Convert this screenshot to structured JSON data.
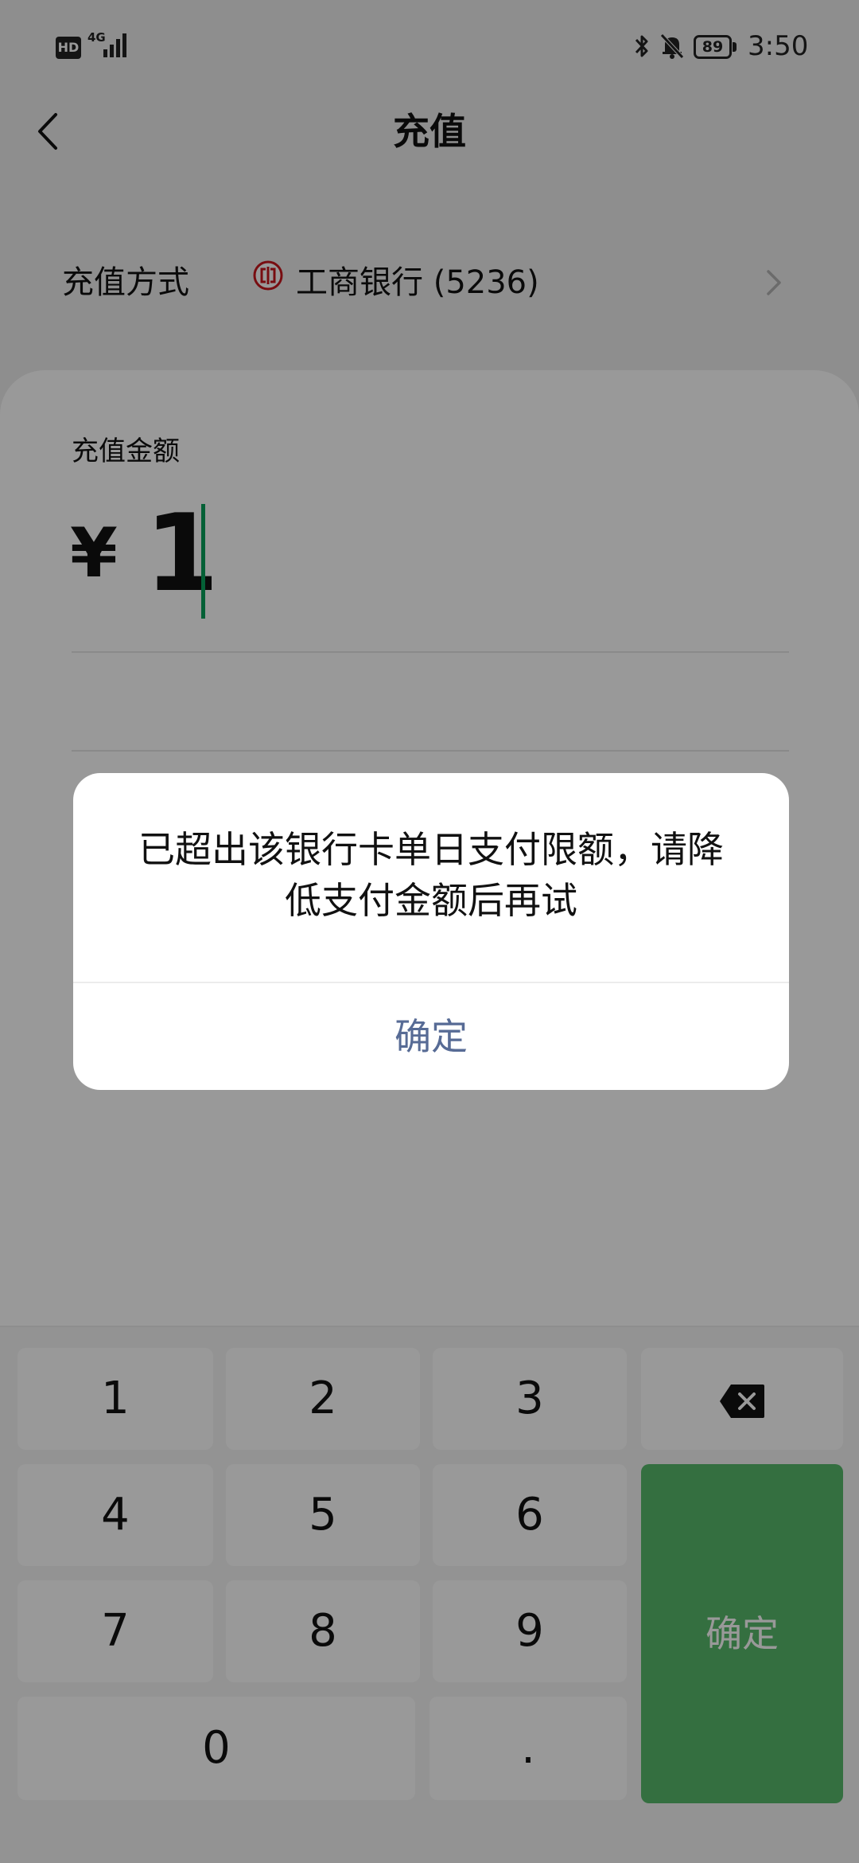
{
  "status_bar": {
    "hd": "HD",
    "network": "4G",
    "battery": "89",
    "time": "3:50"
  },
  "nav": {
    "title": "充值"
  },
  "method": {
    "label": "充值方式",
    "bank": "工商银行 (5236)"
  },
  "amount": {
    "label": "充值金额",
    "currency": "¥",
    "value": "1"
  },
  "keypad": {
    "keys": [
      "1",
      "2",
      "3",
      "4",
      "5",
      "6",
      "7",
      "8",
      "9",
      "0",
      "."
    ],
    "confirm": "确定"
  },
  "dialog": {
    "message": "已超出该银行卡单日支付限额，请降低支付金额后再试",
    "ok": "确定"
  },
  "colors": {
    "accent": "#57b96b",
    "link": "#576b95",
    "cursor": "#07a05a",
    "bank_logo": "#c8161d"
  },
  "icons": [
    "hd-icon",
    "signal-icon",
    "bluetooth-icon",
    "mute-icon",
    "battery-icon",
    "back-arrow-icon",
    "icbc-logo-icon",
    "chevron-right-icon",
    "backspace-icon"
  ]
}
